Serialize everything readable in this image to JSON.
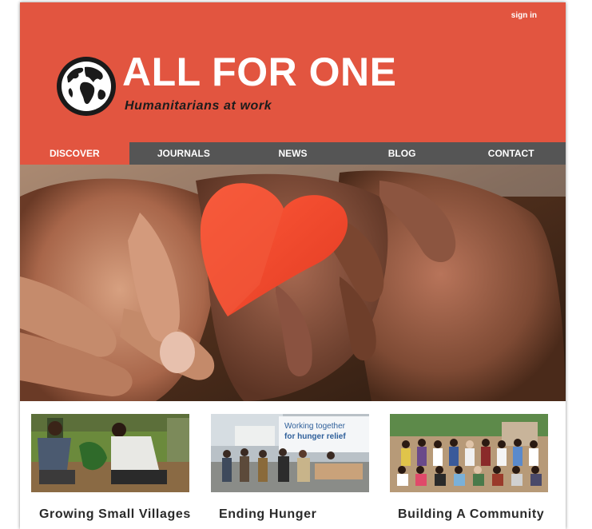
{
  "header": {
    "signin_label": "sign in",
    "brand_title": "ALL FOR ONE",
    "brand_tagline": "Humanitarians at work",
    "background_color": "#e25540"
  },
  "nav": {
    "items": [
      {
        "label": "DISCOVER",
        "active": true
      },
      {
        "label": "JOURNALS",
        "active": false
      },
      {
        "label": "NEWS",
        "active": false
      },
      {
        "label": "BLOG",
        "active": false
      },
      {
        "label": "CONTACT",
        "active": false
      }
    ],
    "background_color": "#555555",
    "active_color": "#e25540"
  },
  "hero": {
    "sign_text": [
      "Working together",
      "for hunger relief"
    ]
  },
  "cards": [
    {
      "caption": "Growing Small Villages"
    },
    {
      "caption": "Ending Hunger",
      "sign_line1": "Working together",
      "sign_line2": "for hunger relief"
    },
    {
      "caption": "Building A Community"
    }
  ]
}
